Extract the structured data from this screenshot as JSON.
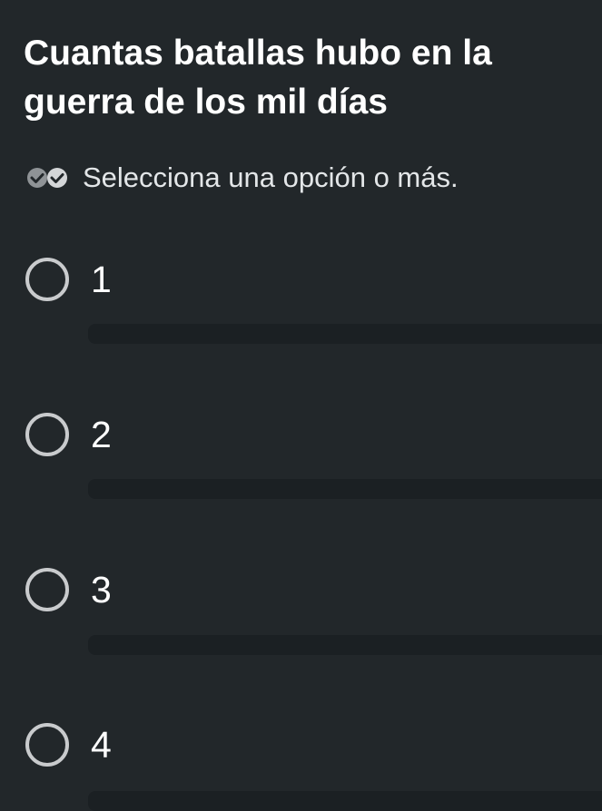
{
  "question": {
    "title": "Cuantas batallas hubo en la guerra de los mil días"
  },
  "hint": {
    "icon": "double-check-icon",
    "text": "Selecciona una opción o más."
  },
  "options": [
    {
      "label": "1"
    },
    {
      "label": "2"
    },
    {
      "label": "3"
    },
    {
      "label": "4"
    }
  ],
  "colors": {
    "background": "#22272a",
    "divider": "#1b2023",
    "radio_border": "#c9cbcd",
    "text": "#ffffff"
  }
}
